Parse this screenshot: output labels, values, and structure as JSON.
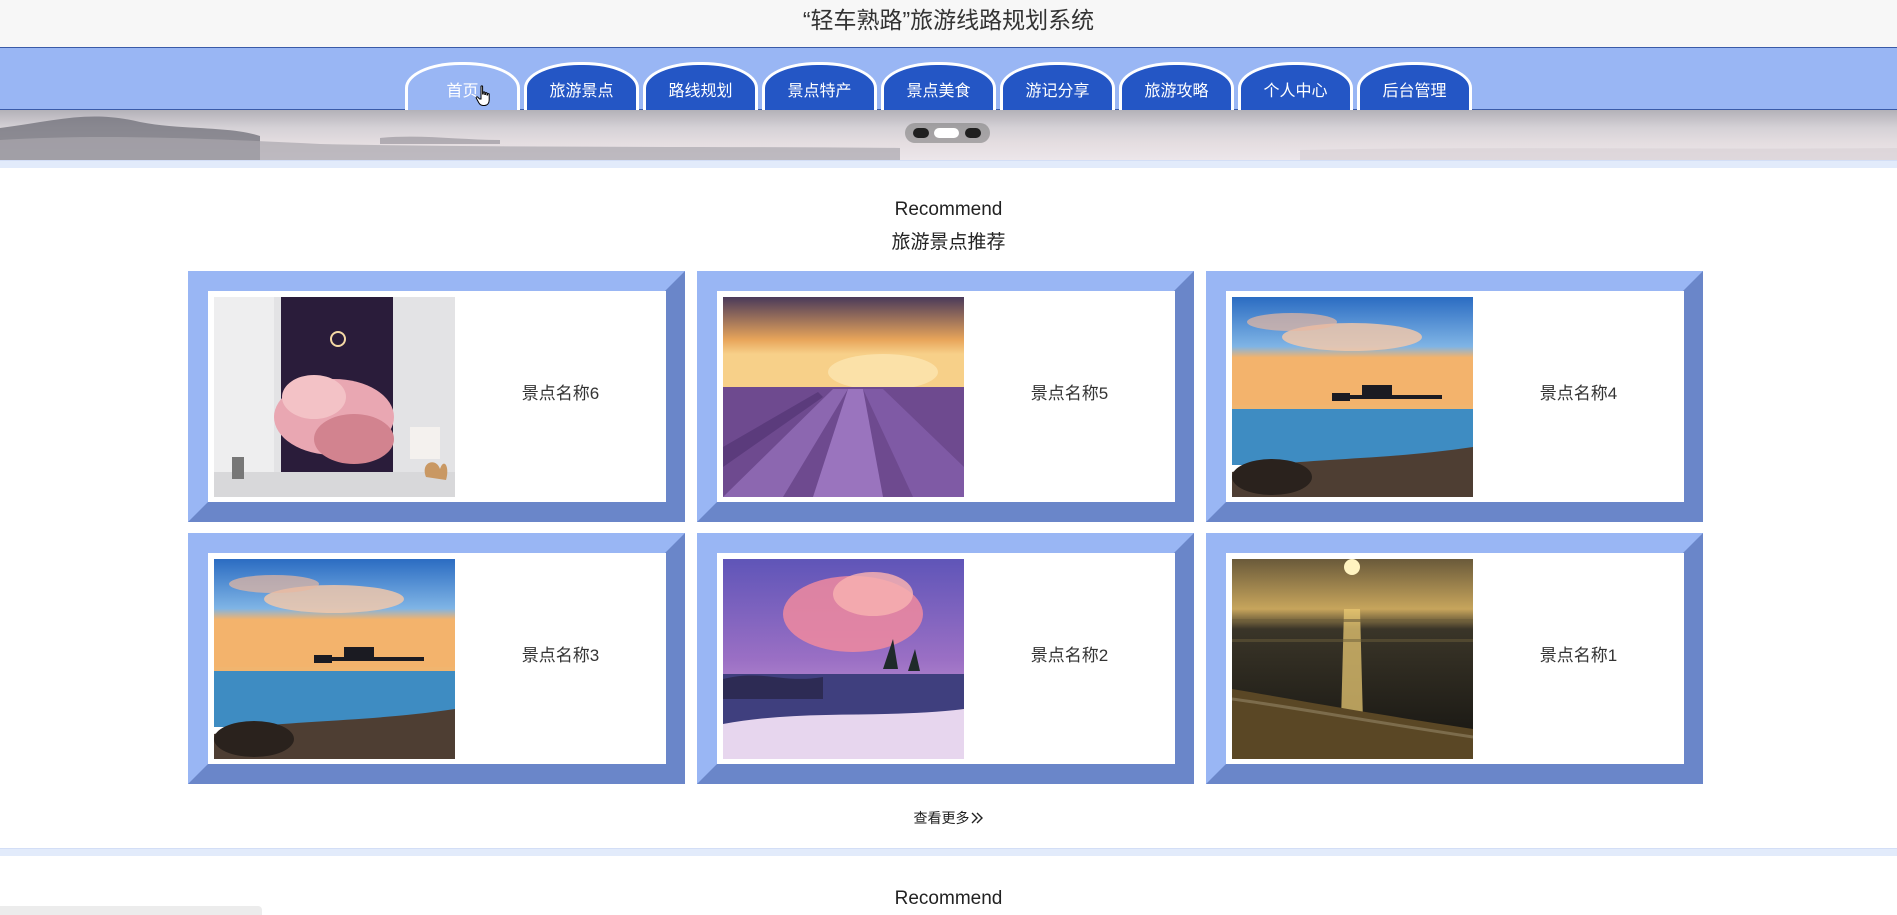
{
  "site": {
    "title": "“轻车熟路”旅游线路规划系统"
  },
  "nav": {
    "items": [
      {
        "label": "首页",
        "active": true
      },
      {
        "label": "旅游景点",
        "active": false
      },
      {
        "label": "路线规划",
        "active": false
      },
      {
        "label": "景点特产",
        "active": false
      },
      {
        "label": "景点美食",
        "active": false
      },
      {
        "label": "游记分享",
        "active": false
      },
      {
        "label": "旅游攻略",
        "active": false
      },
      {
        "label": "个人中心",
        "active": false
      },
      {
        "label": "后台管理",
        "active": false
      }
    ]
  },
  "banner": {
    "active_dot_index": 2,
    "dot_count": 3
  },
  "recommend": {
    "heading_en": "Recommend",
    "heading_cn": "旅游景点推荐",
    "cards": [
      {
        "name": "景点名称6",
        "image": "pink-cloud-poster"
      },
      {
        "name": "景点名称5",
        "image": "lavender-field-sunset"
      },
      {
        "name": "景点名称4",
        "image": "pier-sunset"
      },
      {
        "name": "景点名称3",
        "image": "pier-sunset"
      },
      {
        "name": "景点名称2",
        "image": "purple-cloud-lake"
      },
      {
        "name": "景点名称1",
        "image": "beach-sunset"
      }
    ],
    "more_label": "查看更多",
    "more_icon": "double-chevron-right-icon"
  },
  "next_section": {
    "heading_en": "Recommend"
  },
  "colors": {
    "nav_bg": "#99b6f4",
    "nav_tab": "#2456c5",
    "card_light": "#99b6f4",
    "card_dark": "#6a86c9"
  }
}
